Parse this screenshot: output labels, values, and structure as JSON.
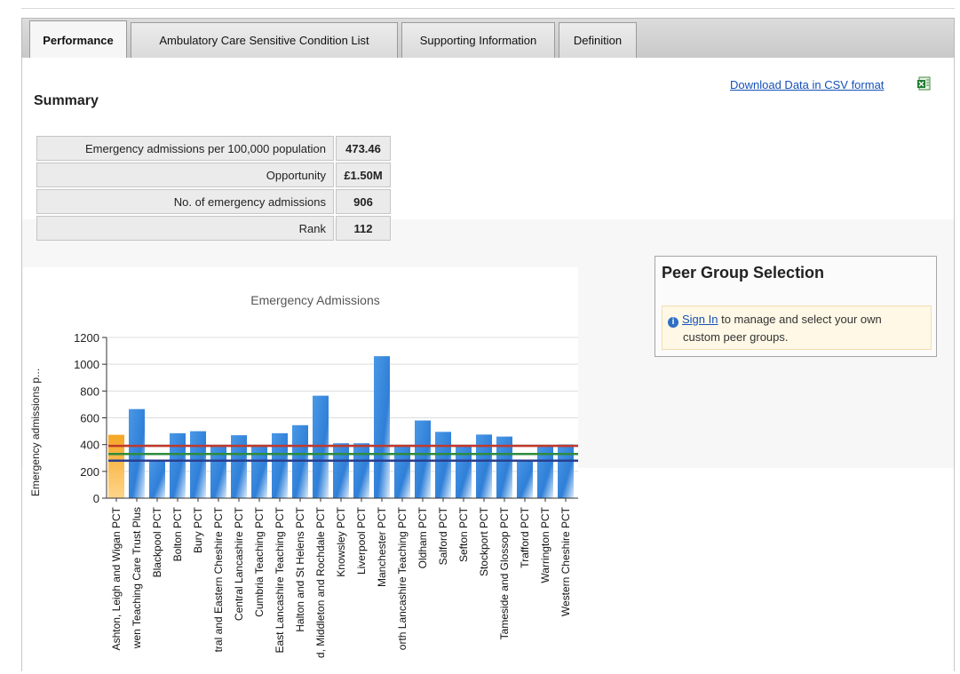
{
  "tabs": [
    {
      "label": "Performance",
      "active": true
    },
    {
      "label": "Ambulatory Care Sensitive Condition List",
      "active": false
    },
    {
      "label": "Supporting Information",
      "active": false
    },
    {
      "label": "Definition",
      "active": false
    }
  ],
  "summary": {
    "title": "Summary",
    "download_label": "Download Data in CSV format",
    "download_icon": "excel-icon",
    "rows": [
      {
        "label": "Emergency admissions per 100,000 population",
        "value": "473.46"
      },
      {
        "label": "Opportunity",
        "value": "£1.50M"
      },
      {
        "label": "No. of emergency admissions",
        "value": "906"
      },
      {
        "label": "Rank",
        "value": "112"
      }
    ]
  },
  "peer_group": {
    "title": "Peer Group Selection",
    "signin_label": "Sign In",
    "note_line1": " to manage and select your own",
    "note_line2": "custom peer groups.",
    "info_icon": "info-icon"
  },
  "colors": {
    "highlight_bar": "#f5a623",
    "bar": "#2f7fd8",
    "line_red": "#c0392b",
    "line_green": "#2e8b3d",
    "line_navy": "#2a3f8f"
  },
  "chart_data": {
    "type": "bar",
    "title": "Emergency Admissions",
    "ylabel": "Emergency admissions p...",
    "ylim": [
      0,
      1200
    ],
    "yticks": [
      0,
      200,
      400,
      600,
      800,
      1000,
      1200
    ],
    "categories": [
      "Ashton, Leigh and Wigan PCT",
      "wen Teaching Care Trust Plus",
      "Blackpool PCT",
      "Bolton PCT",
      "Bury PCT",
      "tral and Eastern Cheshire PCT",
      "Central Lancashire PCT",
      "Cumbria Teaching PCT",
      "East Lancashire Teaching PCT",
      "Halton and St Helens PCT",
      "d, Middleton and Rochdale PCT",
      "Knowsley PCT",
      "Liverpool PCT",
      "Manchester PCT",
      "orth Lancashire Teaching PCT",
      "Oldham PCT",
      "Salford PCT",
      "Sefton PCT",
      "Stockport PCT",
      "Tameside and Glossop PCT",
      "Trafford PCT",
      "Warrington PCT",
      "Western Cheshire PCT"
    ],
    "values": [
      473,
      665,
      285,
      485,
      500,
      385,
      470,
      385,
      485,
      545,
      765,
      410,
      410,
      1060,
      385,
      580,
      495,
      385,
      475,
      460,
      285,
      385,
      400
    ],
    "highlight_index": 0,
    "reference_lines": [
      390,
      330,
      280
    ],
    "grid": true
  }
}
